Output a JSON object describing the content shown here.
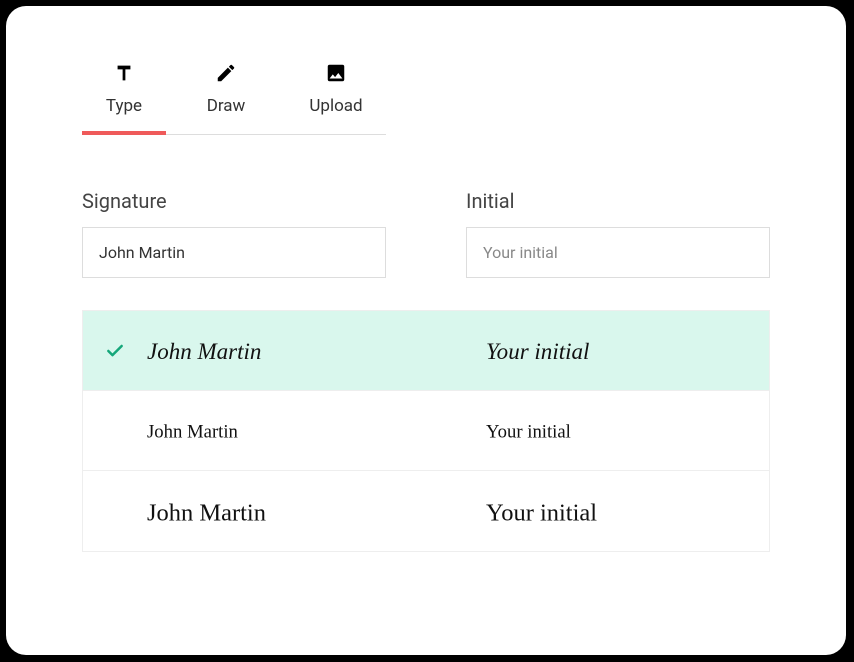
{
  "tabs": {
    "type": "Type",
    "draw": "Draw",
    "upload": "Upload",
    "active": "type"
  },
  "labels": {
    "signature": "Signature",
    "initial": "Initial"
  },
  "inputs": {
    "signature_value": "John Martin",
    "initial_placeholder": "Your initial"
  },
  "preview": {
    "signature_text": "John Martin",
    "initial_text": "Your initial"
  },
  "styles": [
    {
      "selected": true
    },
    {
      "selected": false
    },
    {
      "selected": false
    }
  ],
  "colors": {
    "accent": "#ef5a5a",
    "selected_bg": "#d9f7ed",
    "check": "#15a77a"
  }
}
